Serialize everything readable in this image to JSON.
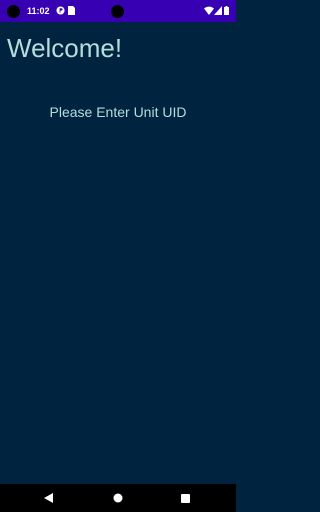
{
  "status_bar": {
    "time": "11:02",
    "background_color": "#3700b3",
    "icons_left": [
      "notification-p-icon",
      "sim-card-icon"
    ],
    "icons_right": [
      "wifi-icon",
      "signal-icon",
      "battery-icon"
    ]
  },
  "main": {
    "title": "Welcome!",
    "prompt": "Please Enter Unit UID",
    "background_color": "#00233f",
    "text_color": "#b2dfdb"
  },
  "nav_bar": {
    "buttons": [
      "back-icon",
      "home-icon",
      "recents-icon"
    ]
  }
}
